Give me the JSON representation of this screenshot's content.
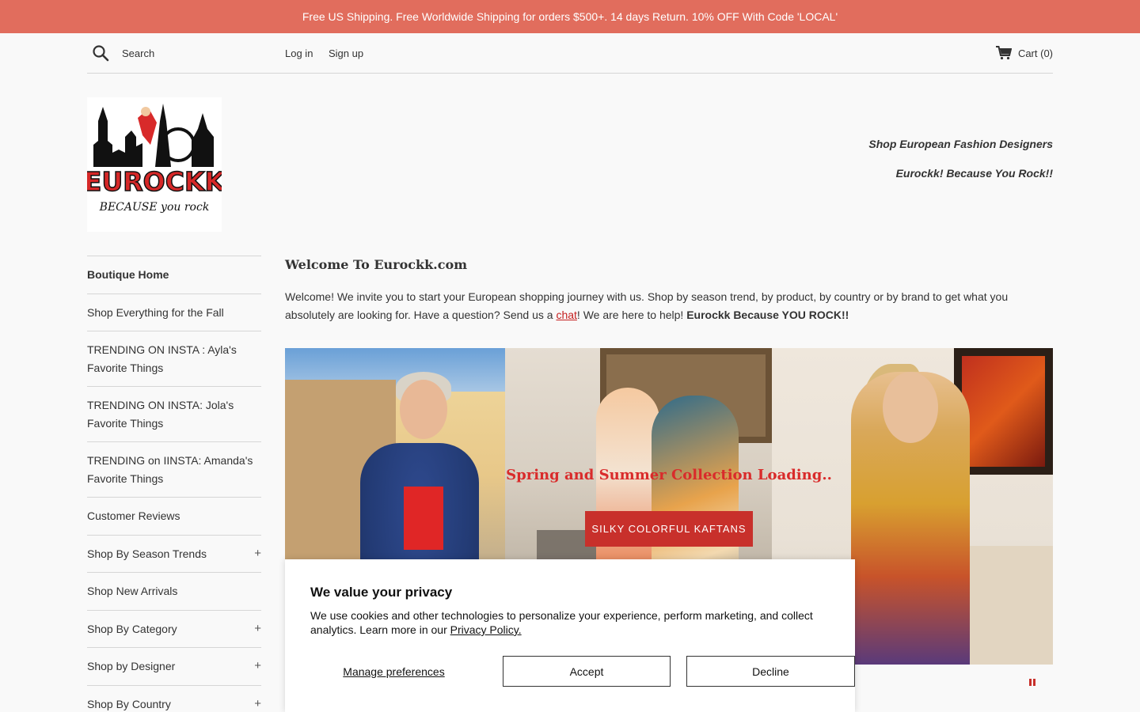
{
  "announcement": "Free US Shipping. Free Worldwide Shipping for orders $500+. 14 days Return. 10% OFF With Code 'LOCAL'",
  "header": {
    "search_label": "Search",
    "login": "Log in",
    "signup": "Sign up",
    "cart": "Cart (0)"
  },
  "logo": {
    "brand": "EUROCKK",
    "slogan": "BECAUSE you rock"
  },
  "taglines": [
    "Shop European Fashion Designers",
    "Eurockk!  Because You Rock!!"
  ],
  "sidebar": {
    "items": [
      {
        "label": "Boutique Home",
        "expandable": false
      },
      {
        "label": "Shop Everything for the Fall",
        "expandable": false
      },
      {
        "label": "TRENDING ON INSTA : Ayla's Favorite Things",
        "expandable": false
      },
      {
        "label": "TRENDING ON INSTA: Jola's Favorite Things",
        "expandable": false
      },
      {
        "label": "TRENDING on IINSTA: Amanda's Favorite Things",
        "expandable": false
      },
      {
        "label": "Customer Reviews",
        "expandable": false
      },
      {
        "label": "Shop By Season Trends",
        "expandable": true
      },
      {
        "label": "Shop New Arrivals",
        "expandable": false
      },
      {
        "label": "Shop By Category",
        "expandable": true
      },
      {
        "label": "Shop by Designer",
        "expandable": true
      },
      {
        "label": "Shop By Country",
        "expandable": true
      }
    ],
    "expand_symbol": "+"
  },
  "main": {
    "title": "Welcome To Eurockk.com",
    "body_pre": "Welcome! We invite you to start your European shopping journey with us. Shop by season trend, by product, by country or by brand to get what you absolutely are looking for. Have a question? Send us a ",
    "body_link": "chat",
    "body_post": "! We are here to help! ",
    "body_bold": "Eurockk Because YOU ROCK!!"
  },
  "hero": {
    "caption": "Spring and Summer Collection Loading..",
    "button": "SILKY COLORFUL KAFTANS"
  },
  "cookie": {
    "title": "We value your privacy",
    "text": "We use cookies and other technologies to personalize your experience, perform marketing, and collect analytics. Learn more in our ",
    "link": "Privacy Policy.",
    "manage": "Manage preferences",
    "accept": "Accept",
    "decline": "Decline"
  }
}
